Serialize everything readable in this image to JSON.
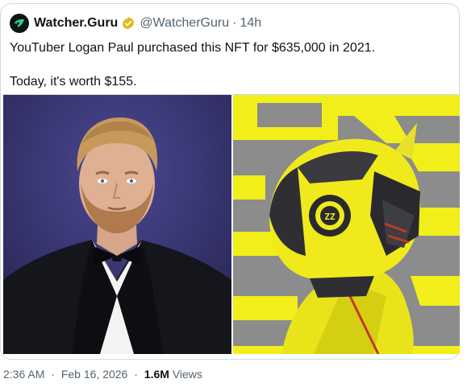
{
  "author": {
    "name": "Watcher.Guru",
    "handle": "@WatcherGuru",
    "time_ago": "14h",
    "verified_color": "#e2b719",
    "avatar_icon": "eye-logo"
  },
  "tweet": {
    "line1": "YouTuber Logan Paul purchased this NFT for $635,000 in 2021.",
    "line2": "Today, it's worth $155."
  },
  "media": {
    "left_image": "photo-of-man-in-tuxedo",
    "right_image": "yellow-robot-helmet-nft-artwork"
  },
  "footer": {
    "time": "2:36 AM",
    "date": "Feb 16, 2026",
    "views_count": "1.6M",
    "views_label": "Views"
  }
}
